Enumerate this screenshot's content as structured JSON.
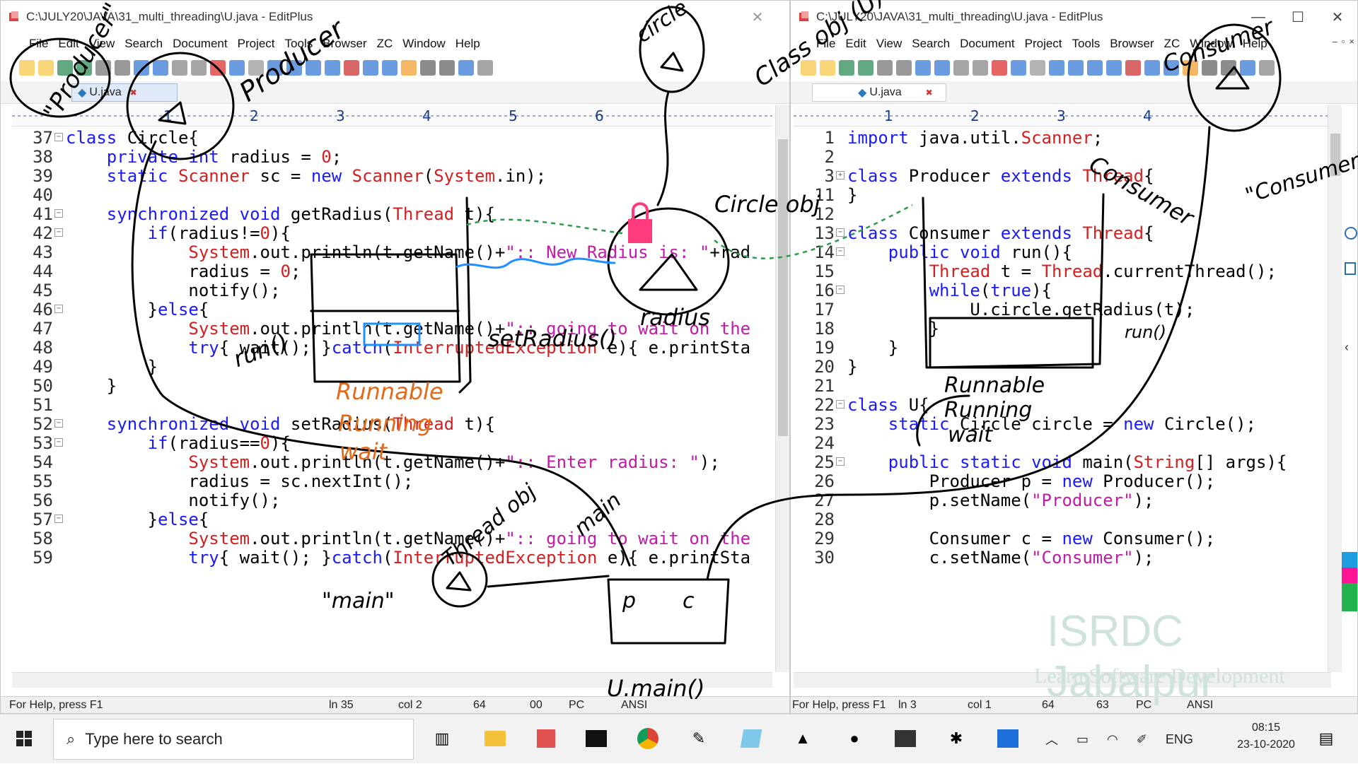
{
  "left": {
    "title": "C:\\JULY20\\JAVA\\31_multi_threading\\U.java - EditPlus",
    "menu": [
      "File",
      "Edit",
      "View",
      "Search",
      "Document",
      "Project",
      "Tools",
      "Browser",
      "ZC",
      "Window",
      "Help"
    ],
    "tab": "U.java",
    "ruler_marks": [
      "1",
      "2",
      "3",
      "4",
      "5",
      "6"
    ],
    "lines": [
      {
        "n": "37",
        "t": "class Circle{"
      },
      {
        "n": "38",
        "t": "    private int radius = 0;"
      },
      {
        "n": "39",
        "t": "    static Scanner sc = new Scanner(System.in);"
      },
      {
        "n": "40",
        "t": ""
      },
      {
        "n": "41",
        "t": "    synchronized void getRadius(Thread t){"
      },
      {
        "n": "42",
        "t": "        if(radius!=0){"
      },
      {
        "n": "43",
        "t": "            System.out.println(t.getName()+\":: New Radius is: \"+rad"
      },
      {
        "n": "44",
        "t": "            radius = 0;"
      },
      {
        "n": "45",
        "t": "            notify();"
      },
      {
        "n": "46",
        "t": "        }else{"
      },
      {
        "n": "47",
        "t": "            System.out.println(t.getName()+\":: going to wait on the"
      },
      {
        "n": "48",
        "t": "            try{ wait(); }catch(InterruptedException e){ e.printSta"
      },
      {
        "n": "49",
        "t": "        }"
      },
      {
        "n": "50",
        "t": "    }"
      },
      {
        "n": "51",
        "t": ""
      },
      {
        "n": "52",
        "t": "    synchronized void setRadius(Thread t){"
      },
      {
        "n": "53",
        "t": "        if(radius==0){"
      },
      {
        "n": "54",
        "t": "            System.out.println(t.getName()+\":: Enter radius: \");"
      },
      {
        "n": "55",
        "t": "            radius = sc.nextInt();"
      },
      {
        "n": "56",
        "t": "            notify();"
      },
      {
        "n": "57",
        "t": "        }else{"
      },
      {
        "n": "58",
        "t": "            System.out.println(t.getName()+\":: going to wait on the"
      },
      {
        "n": "59",
        "t": "            try{ wait(); }catch(InterruptedException e){ e.printSta"
      }
    ],
    "status": {
      "help": "For Help, press F1",
      "ln": "ln 35",
      "col": "col 2",
      "a": "64",
      "b": "00",
      "pc": "PC",
      "enc": "ANSI"
    }
  },
  "right": {
    "title": "C:\\JULY20\\JAVA\\31_multi_threading\\U.java - EditPlus",
    "menu": [
      "File",
      "Edit",
      "View",
      "Search",
      "Document",
      "Project",
      "Tools",
      "Browser",
      "ZC",
      "Window",
      "Help"
    ],
    "tab": "U.java",
    "ruler_marks": [
      "1",
      "2",
      "3",
      "4"
    ],
    "lines": [
      {
        "n": "1",
        "t": "import java.util.Scanner;"
      },
      {
        "n": "2",
        "t": ""
      },
      {
        "n": "3",
        "t": "class Producer extends Thread{"
      },
      {
        "n": "11",
        "t": "}"
      },
      {
        "n": "12",
        "t": ""
      },
      {
        "n": "13",
        "t": "class Consumer extends Thread{"
      },
      {
        "n": "14",
        "t": "    public void run(){"
      },
      {
        "n": "15",
        "t": "        Thread t = Thread.currentThread();"
      },
      {
        "n": "16",
        "t": "        while(true){"
      },
      {
        "n": "17",
        "t": "            U.circle.getRadius(t);"
      },
      {
        "n": "18",
        "t": "        }"
      },
      {
        "n": "19",
        "t": "    }"
      },
      {
        "n": "20",
        "t": "}"
      },
      {
        "n": "21",
        "t": ""
      },
      {
        "n": "22",
        "t": "class U{"
      },
      {
        "n": "23",
        "t": "    static Circle circle = new Circle();"
      },
      {
        "n": "24",
        "t": ""
      },
      {
        "n": "25",
        "t": "    public static void main(String[] args){"
      },
      {
        "n": "26",
        "t": "        Producer p = new Producer();"
      },
      {
        "n": "27",
        "t": "        p.setName(\"Producer\");"
      },
      {
        "n": "28",
        "t": ""
      },
      {
        "n": "29",
        "t": "        Consumer c = new Consumer();"
      },
      {
        "n": "30",
        "t": "        c.setName(\"Consumer\");"
      }
    ],
    "status": {
      "help": "For Help, press F1",
      "ln": "ln 3",
      "col": "col 1",
      "a": "64",
      "b": "63",
      "pc": "PC",
      "enc": "ANSI"
    }
  },
  "annotations": {
    "producer": "Producer",
    "producer_boxed": "\"Producer\"",
    "circle": "circle",
    "class_u": "Class obj (U)",
    "circle_obj": "Circle obj",
    "radius": "radius",
    "set_radius": "setRadius()",
    "run": "run()",
    "runnable": "Runnable",
    "running": "Running",
    "wait": "wait",
    "thread_obj": "Thread obj",
    "main": "main",
    "main_quoted": "\"main\"",
    "u_main": "U.main()",
    "consumer": "Consumer",
    "consumer_quoted": "\"Consumer\"",
    "run_r": "run()",
    "runnable_r": "Runnable",
    "running_r": "Running",
    "wait_r": "wait",
    "p": "p",
    "c": "c"
  },
  "watermark": {
    "brand": "ISRDC Jabalpur",
    "tagline": "Learn Software Development"
  },
  "taskbar": {
    "search_placeholder": "Type here to search",
    "lang": "ENG",
    "time": "08:15",
    "date": "23-10-2020"
  },
  "colors": {
    "keyword": "#1a1aff",
    "type": "#d42020",
    "string": "#c41aa8",
    "ink": "#000000",
    "ink_orange": "#e26a18",
    "ink_blue": "#1e90ff",
    "ink_green": "#2a9d4b",
    "ink_pink": "#e0156f"
  }
}
